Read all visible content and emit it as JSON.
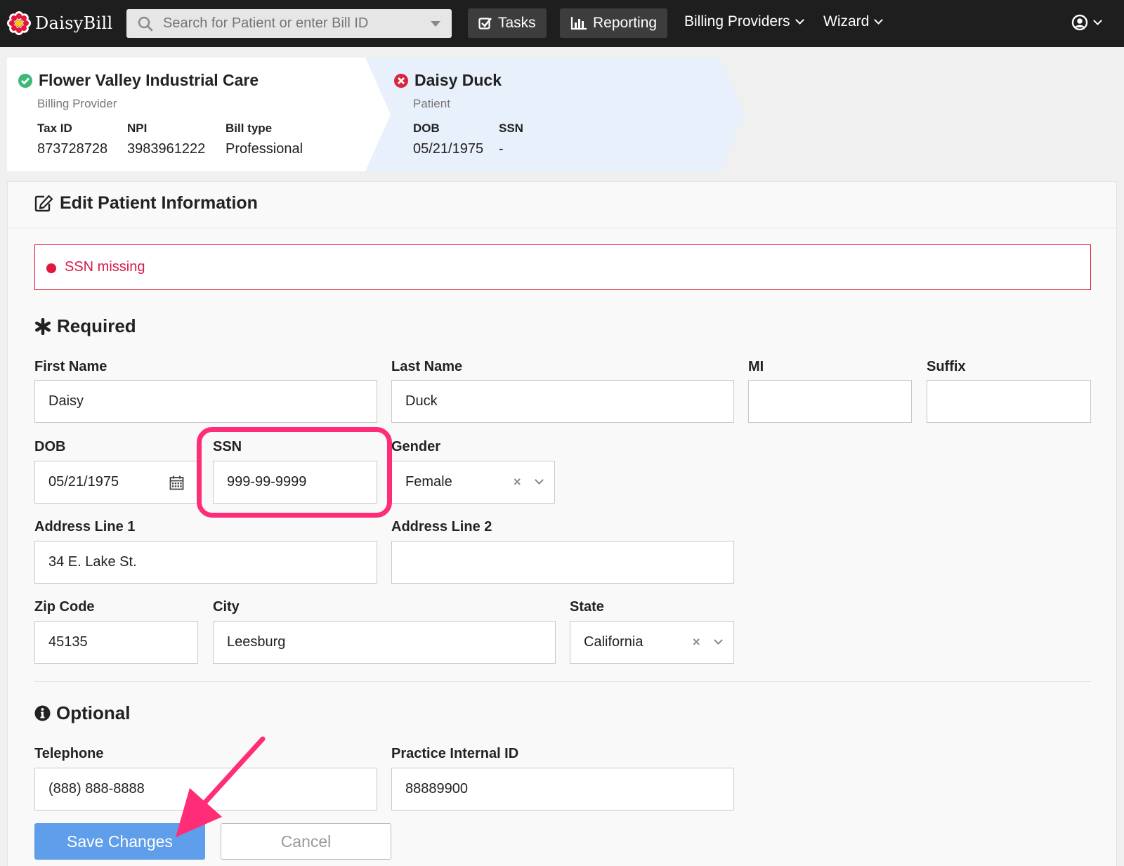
{
  "app": {
    "name": "DaisyBill"
  },
  "topnav": {
    "search_placeholder": "Search for Patient or enter Bill ID",
    "tasks_label": "Tasks",
    "reporting_label": "Reporting",
    "billing_providers_label": "Billing Providers",
    "wizard_label": "Wizard"
  },
  "breadcrumb": {
    "provider": {
      "name": "Flower Valley Industrial Care",
      "role": "Billing Provider",
      "tax_id_label": "Tax ID",
      "tax_id": "873728728",
      "npi_label": "NPI",
      "npi": "3983961222",
      "bill_type_label": "Bill type",
      "bill_type": "Professional",
      "status": "valid"
    },
    "patient": {
      "name": "Daisy Duck",
      "role": "Patient",
      "dob_label": "DOB",
      "dob": "05/21/1975",
      "ssn_label": "SSN",
      "ssn": "-",
      "status": "error"
    }
  },
  "form": {
    "title": "Edit Patient Information",
    "alert": "SSN missing",
    "required_title": "Required",
    "optional_title": "Optional",
    "fields": {
      "first_name": {
        "label": "First Name",
        "value": "Daisy"
      },
      "last_name": {
        "label": "Last Name",
        "value": "Duck"
      },
      "mi": {
        "label": "MI",
        "value": ""
      },
      "suffix": {
        "label": "Suffix",
        "value": ""
      },
      "dob": {
        "label": "DOB",
        "value": "05/21/1975"
      },
      "ssn": {
        "label": "SSN",
        "value": "999-99-9999"
      },
      "gender": {
        "label": "Gender",
        "value": "Female"
      },
      "address1": {
        "label": "Address Line 1",
        "value": "34 E. Lake St."
      },
      "address2": {
        "label": "Address Line 2",
        "value": ""
      },
      "zip": {
        "label": "Zip Code",
        "value": "45135"
      },
      "city": {
        "label": "City",
        "value": "Leesburg"
      },
      "state": {
        "label": "State",
        "value": "California"
      },
      "telephone": {
        "label": "Telephone",
        "value": "(888) 888-8888"
      },
      "internal_id": {
        "label": "Practice Internal ID",
        "value": "88889900"
      }
    },
    "save_label": "Save Changes",
    "cancel_label": "Cancel"
  },
  "colors": {
    "nav_bg": "#1e1e1e",
    "accent": "#5f9eea",
    "error": "#e3163c",
    "success": "#3cb878",
    "annotation": "#ff2d78"
  },
  "icons": [
    "daisy-logo-icon",
    "search-icon",
    "tasks-check-icon",
    "reporting-chart-icon",
    "user-circle-icon",
    "check-circle-icon",
    "error-circle-icon",
    "edit-icon",
    "asterisk-icon",
    "info-circle-icon",
    "calendar-icon",
    "clear-icon",
    "chevron-down-icon"
  ]
}
